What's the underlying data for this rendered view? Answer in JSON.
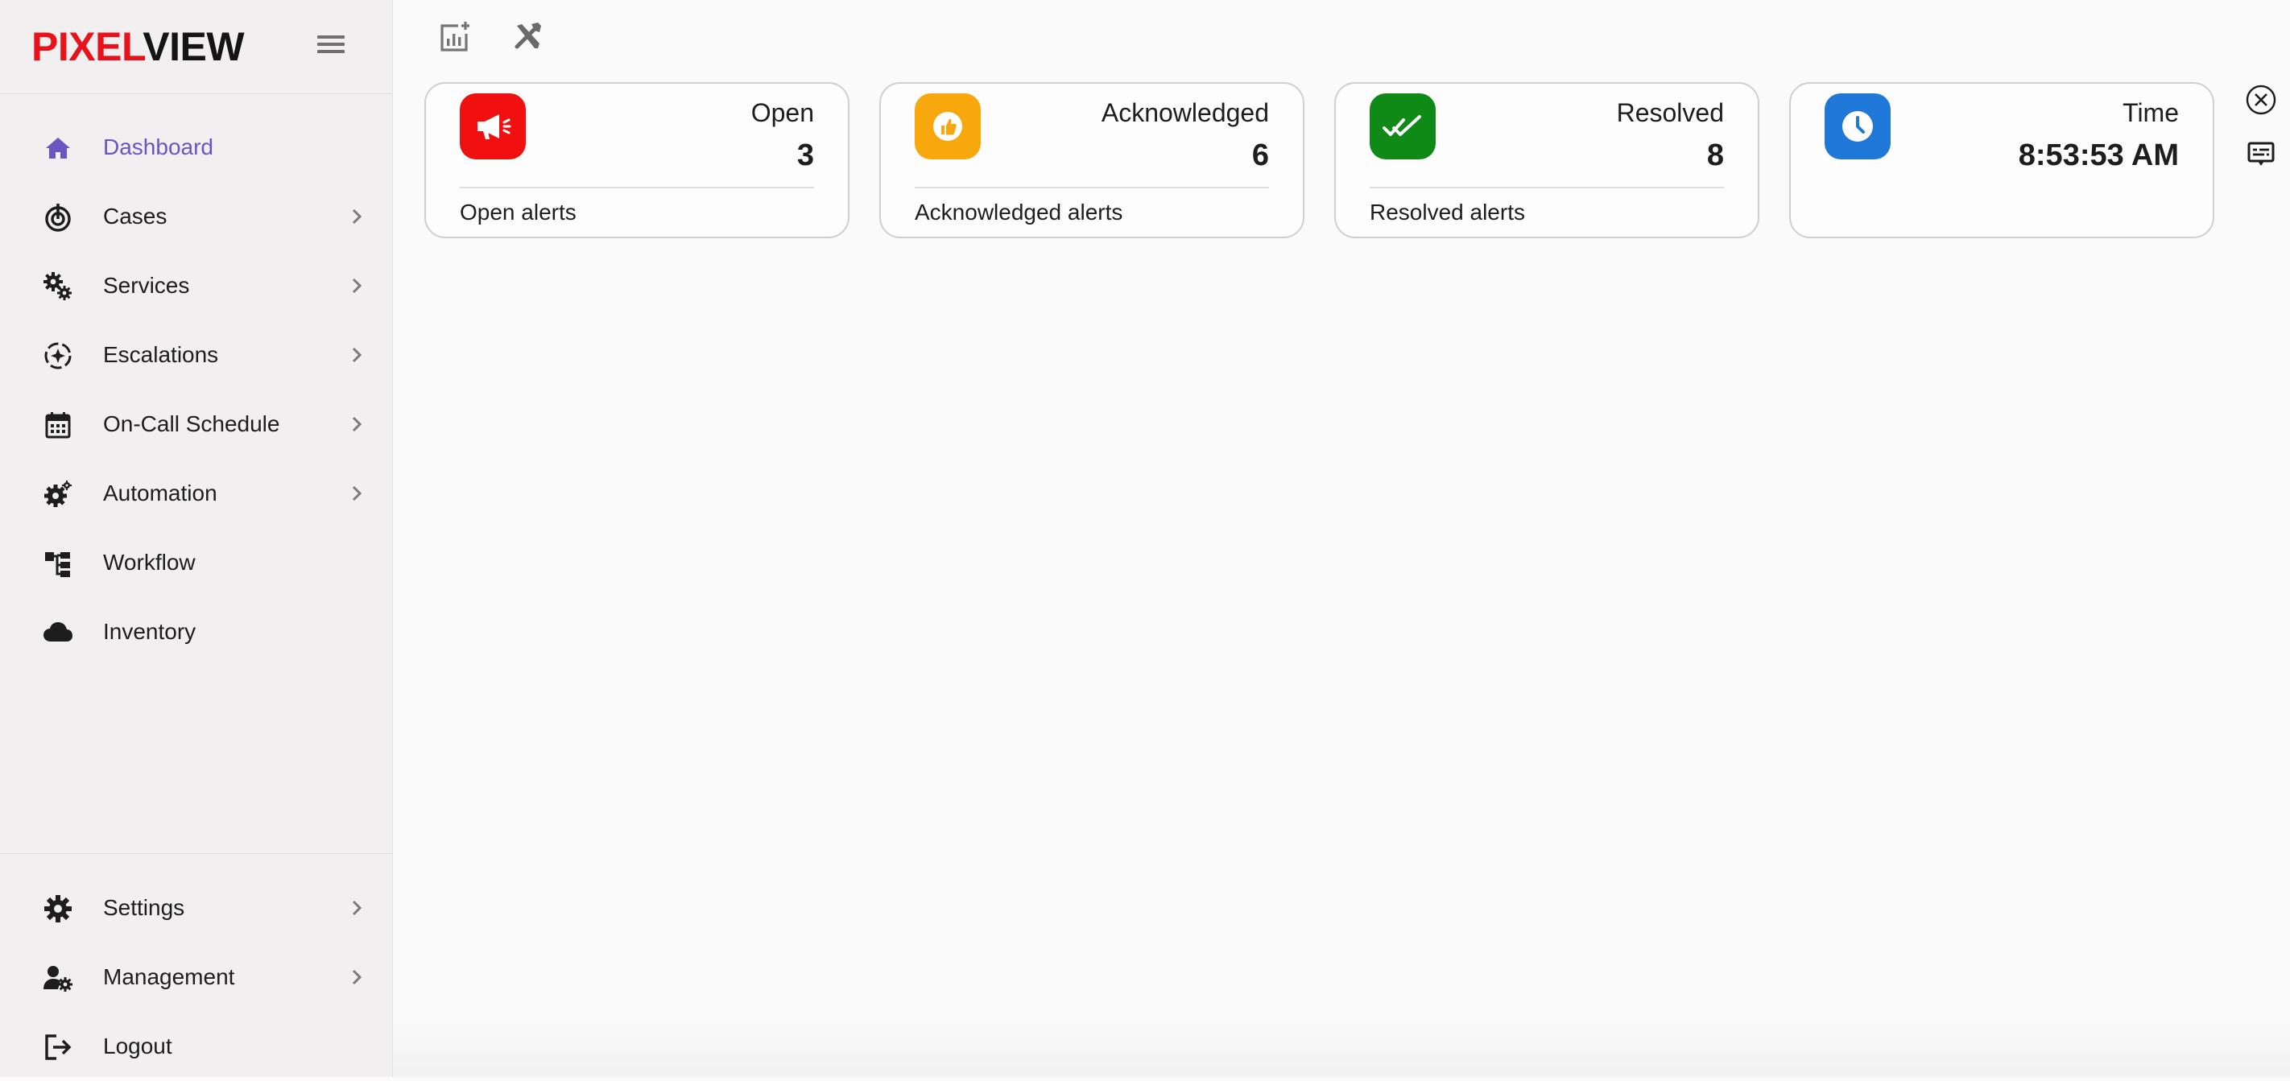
{
  "brand": {
    "logo_part1": "PIXEL",
    "logo_part2": "VIEW"
  },
  "colors": {
    "logo_red": "#e8121b",
    "active_nav": "#6a55c2",
    "open_badge": "#f01010",
    "acknowledged_badge": "#f8a70c",
    "resolved_badge": "#0f8a17",
    "time_badge": "#1f78d8"
  },
  "sidebar": {
    "menu_icon": "hamburger-icon",
    "items": [
      {
        "label": "Dashboard",
        "icon": "home-icon",
        "active": true,
        "has_submenu": false
      },
      {
        "label": "Cases",
        "icon": "target-icon",
        "has_submenu": true
      },
      {
        "label": "Services",
        "icon": "gears-icon",
        "has_submenu": true
      },
      {
        "label": "Escalations",
        "icon": "escalation-icon",
        "has_submenu": true
      },
      {
        "label": "On-Call Schedule",
        "icon": "calendar-icon",
        "has_submenu": true
      },
      {
        "label": "Automation",
        "icon": "gear-cog-icon",
        "has_submenu": true
      },
      {
        "label": "Workflow",
        "icon": "workflow-icon",
        "has_submenu": false
      },
      {
        "label": "Inventory",
        "icon": "cloud-icon",
        "has_submenu": false
      }
    ],
    "bottom_items": [
      {
        "label": "Settings",
        "icon": "settings-icon",
        "has_submenu": true
      },
      {
        "label": "Management",
        "icon": "user-gear-icon",
        "has_submenu": true
      },
      {
        "label": "Logout",
        "icon": "logout-icon",
        "has_submenu": false
      }
    ]
  },
  "toolbar": {
    "add_widget_icon": "add-chart-icon",
    "tools_icon": "tools-icon"
  },
  "cards": [
    {
      "title": "Open",
      "value": "3",
      "footer": "Open alerts",
      "icon": "megaphone-icon"
    },
    {
      "title": "Acknowledged",
      "value": "6",
      "footer": "Acknowledged alerts",
      "icon": "thumbs-up-icon"
    },
    {
      "title": "Resolved",
      "value": "8",
      "footer": "Resolved alerts",
      "icon": "double-check-icon"
    },
    {
      "title": "Time",
      "value": "8:53:53 AM",
      "icon": "clock-icon"
    }
  ],
  "side_actions": {
    "close_icon": "close-circle-icon",
    "subtitles_icon": "subtitles-icon"
  }
}
